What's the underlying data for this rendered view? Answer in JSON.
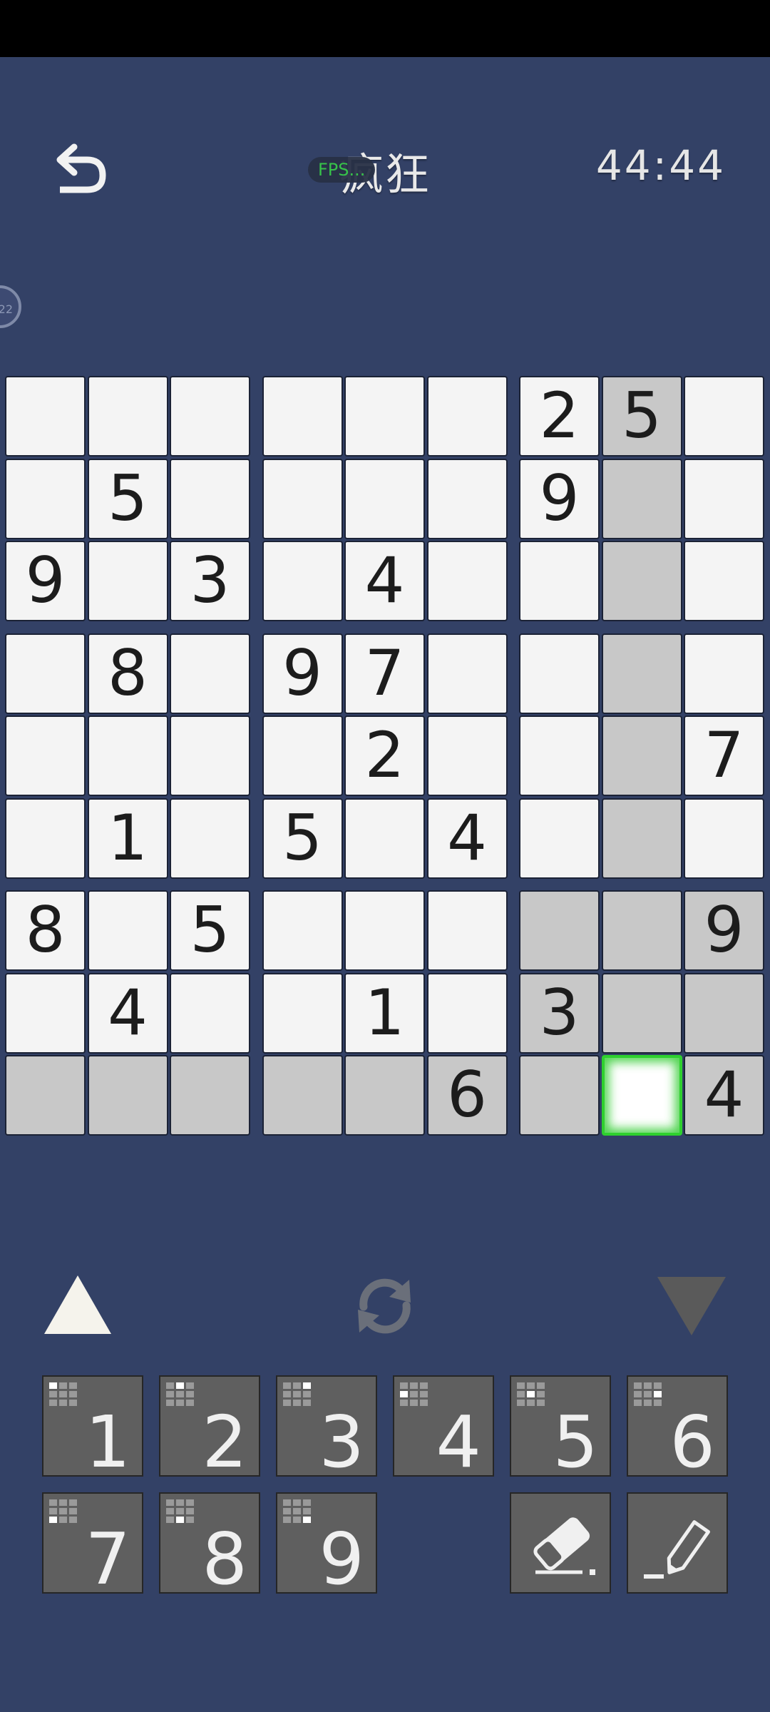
{
  "header": {
    "title": "疯狂",
    "fps_badge": "FPS...",
    "timer": "44:44",
    "side_bubble": "22"
  },
  "board": [
    [
      0,
      0,
      0,
      0,
      0,
      0,
      2,
      5,
      0
    ],
    [
      0,
      5,
      0,
      0,
      0,
      0,
      9,
      0,
      0
    ],
    [
      9,
      0,
      3,
      0,
      4,
      0,
      0,
      0,
      0
    ],
    [
      0,
      8,
      0,
      9,
      7,
      0,
      0,
      0,
      0
    ],
    [
      0,
      0,
      0,
      0,
      2,
      0,
      0,
      0,
      7
    ],
    [
      0,
      1,
      0,
      5,
      0,
      4,
      0,
      0,
      0
    ],
    [
      8,
      0,
      5,
      0,
      0,
      0,
      0,
      0,
      9
    ],
    [
      0,
      4,
      0,
      0,
      1,
      0,
      3,
      0,
      0
    ],
    [
      0,
      0,
      0,
      0,
      0,
      6,
      0,
      0,
      4
    ]
  ],
  "selected": {
    "row": 8,
    "col": 7
  },
  "keypad": {
    "numbers": [
      "1",
      "2",
      "3",
      "4",
      "5",
      "6",
      "7",
      "8",
      "9"
    ]
  },
  "colors": {
    "background": "#334166",
    "cell": "#f4f4f4",
    "highlight": "#c8c8c8",
    "selection": "#2ed02e",
    "key": "#5f5f5f"
  }
}
